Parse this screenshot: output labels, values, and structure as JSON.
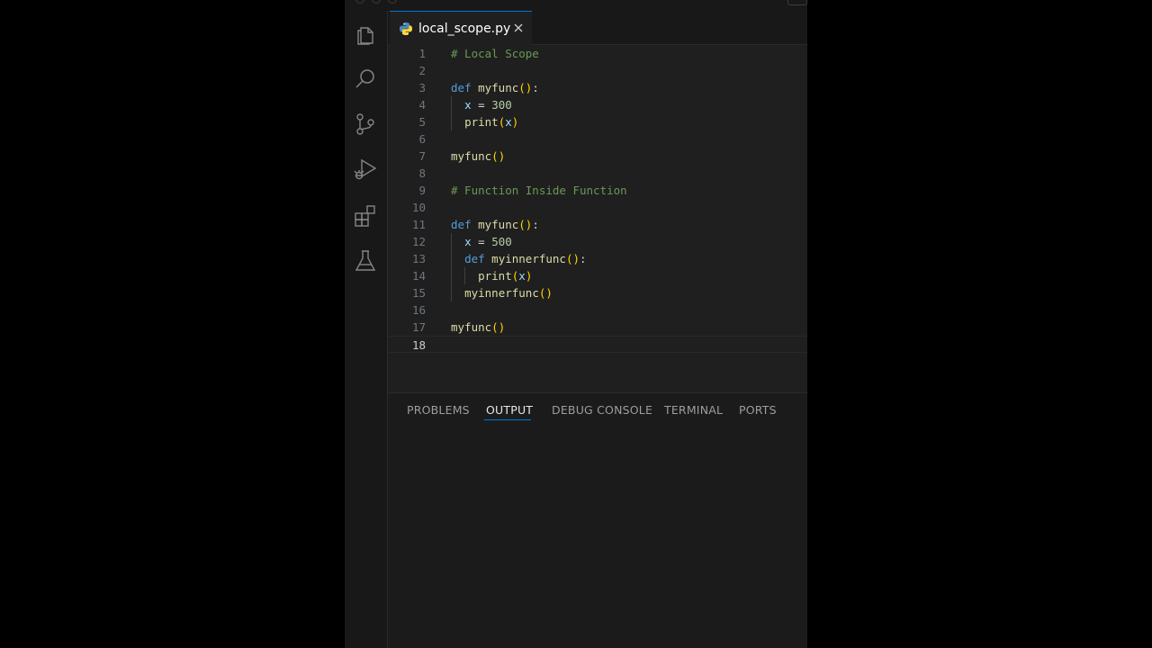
{
  "editor_tab": {
    "filename": "local_scope.py",
    "close": "✕"
  },
  "code_lines": [
    {
      "n": "1",
      "text": "# Local Scope"
    },
    {
      "n": "2",
      "text": ""
    },
    {
      "n": "3",
      "text": "def myfunc():"
    },
    {
      "n": "4",
      "text": "  x = 300"
    },
    {
      "n": "5",
      "text": "  print(x)"
    },
    {
      "n": "6",
      "text": ""
    },
    {
      "n": "7",
      "text": "myfunc()"
    },
    {
      "n": "8",
      "text": ""
    },
    {
      "n": "9",
      "text": "# Function Inside Function"
    },
    {
      "n": "10",
      "text": ""
    },
    {
      "n": "11",
      "text": "def myfunc():"
    },
    {
      "n": "12",
      "text": "  x = 500"
    },
    {
      "n": "13",
      "text": "  def myinnerfunc():"
    },
    {
      "n": "14",
      "text": "    print(x)"
    },
    {
      "n": "15",
      "text": "  myinnerfunc()"
    },
    {
      "n": "16",
      "text": ""
    },
    {
      "n": "17",
      "text": "myfunc()"
    },
    {
      "n": "18",
      "text": ""
    }
  ],
  "active_line": "18",
  "panel_tabs": [
    {
      "label": "PROBLEMS",
      "active": false
    },
    {
      "label": "OUTPUT",
      "active": true
    },
    {
      "label": "DEBUG CONSOLE",
      "active": false
    },
    {
      "label": "TERMINAL",
      "active": false
    },
    {
      "label": "PORTS",
      "active": false
    }
  ],
  "activity_icons": [
    "explorer-icon",
    "search-icon",
    "source-control-icon",
    "run-debug-icon",
    "extensions-icon",
    "testing-icon"
  ],
  "colors": {
    "accent": "#0078d4",
    "editor_bg": "#1f1f1f",
    "sidebar_bg": "#181818"
  }
}
